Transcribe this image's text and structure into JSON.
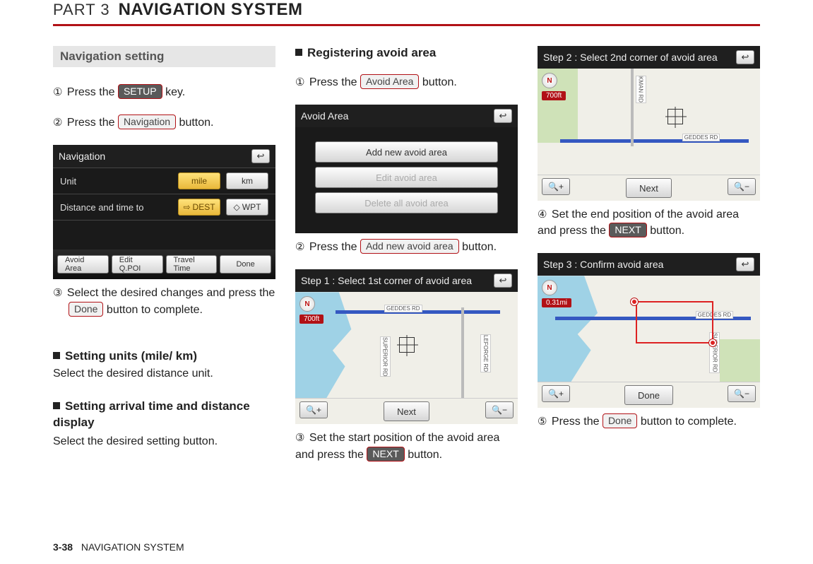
{
  "header": {
    "part_label": "PART 3",
    "title": "NAVIGATION SYSTEM"
  },
  "col1": {
    "section_heading": "Navigation setting",
    "step1_a": "Press the ",
    "step1_btn": "SETUP",
    "step1_b": " key.",
    "step2_a": "Press the ",
    "step2_btn": "Navigation",
    "step2_b": " button.",
    "shot": {
      "title": "Navigation",
      "row_unit": "Unit",
      "unit_mile": "mile",
      "unit_km": "km",
      "row_dist": "Distance and time to",
      "dest": "DEST",
      "wpt": "WPT",
      "b1": "Avoid Area",
      "b2": "Edit Q.POI",
      "b3": "Travel Time",
      "b4": "Done"
    },
    "step3_a": "Select the desired changes and press the ",
    "step3_btn": "Done",
    "step3_b": " button to complete.",
    "sub1_h": "Setting units (mile/ km)",
    "sub1_t": "Select the desired distance unit.",
    "sub2_h": "Setting arrival time and distance display",
    "sub2_t": "Select the desired setting button."
  },
  "col2": {
    "sub_h": "Registering avoid area",
    "step1_a": "Press the ",
    "step1_btn": "Avoid Area",
    "step1_b": " button.",
    "shot_list": {
      "title": "Avoid Area",
      "b1": "Add new avoid area",
      "b2": "Edit avoid area",
      "b3": "Delete all avoid area"
    },
    "step2_a": "Press the ",
    "step2_btn": "Add new avoid area",
    "step2_b": " button.",
    "shot_map1": {
      "title": "Step 1 : Select 1st corner of avoid area",
      "road1": "GEDDES RD",
      "road2": "LEFORGE RD",
      "road3": "SUPERIOR RD",
      "scale": "700ft",
      "compass": "N",
      "next": "Next"
    },
    "step3_a": "Set the start position of the avoid area and press the ",
    "step3_btn": "NEXT",
    "step3_b": " button."
  },
  "col3": {
    "shot_map2": {
      "title": "Step 2 : Select 2nd corner of avoid area",
      "road1": "GEDDES RD",
      "road2": "KMAN RD",
      "scale": "700ft",
      "compass": "N",
      "next": "Next"
    },
    "step4_a": "Set the end position of the avoid area and press the ",
    "step4_btn": "NEXT",
    "step4_b": " button.",
    "shot_map3": {
      "title": "Step 3 : Confirm avoid area",
      "road1": "GEDDES RD",
      "road2": "SUPERIOR RD",
      "scale": "0.31mi",
      "compass": "N",
      "done": "Done"
    },
    "step5_a": "Press the ",
    "step5_btn": "Done",
    "step5_b": " button to complete."
  },
  "footer": {
    "page": "3-38",
    "label": "NAVIGATION SYSTEM"
  },
  "glyph": {
    "back": "↩",
    "dest_icon": "⇨",
    "wpt_icon": "◇",
    "plus": "+",
    "minus": "−",
    "n1": "①",
    "n2": "②",
    "n3": "③",
    "n4": "④",
    "n5": "⑤"
  }
}
